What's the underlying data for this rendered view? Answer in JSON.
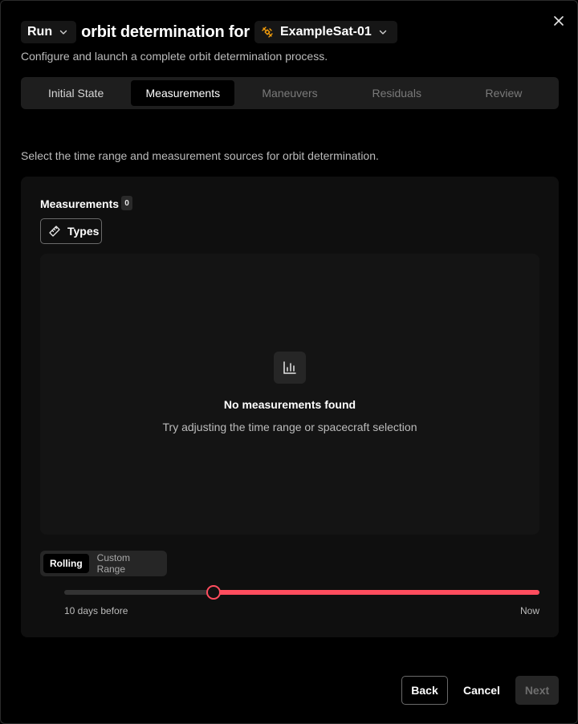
{
  "header": {
    "mode_value": "Run",
    "title": "orbit determination for",
    "satellite": "ExampleSat-01",
    "subtitle": "Configure and launch a complete orbit determination process."
  },
  "tabs": [
    {
      "label": "Initial State",
      "state": "normal"
    },
    {
      "label": "Measurements",
      "state": "active"
    },
    {
      "label": "Maneuvers",
      "state": "disabled"
    },
    {
      "label": "Residuals",
      "state": "disabled"
    },
    {
      "label": "Review",
      "state": "disabled"
    }
  ],
  "section_description": "Select the time range and measurement sources for orbit determination.",
  "measurements": {
    "label": "Measurements",
    "count": "0",
    "types_button": "Types",
    "empty_title": "No measurements found",
    "empty_hint": "Try adjusting the time range or spacecraft selection"
  },
  "range": {
    "options": [
      "Rolling",
      "Custom Range"
    ],
    "selected": "Rolling",
    "slider_min_label": "10 days before",
    "slider_max_label": "Now",
    "slider_value_fraction": 0.314
  },
  "footer": {
    "back": "Back",
    "cancel": "Cancel",
    "next": "Next"
  },
  "colors": {
    "accent": "#ff4d5e",
    "satellite_icon": "#f59e0b"
  },
  "icons": [
    "chevron-down-icon",
    "satellite-icon",
    "close-icon",
    "ruler-icon",
    "bar-chart-icon"
  ]
}
